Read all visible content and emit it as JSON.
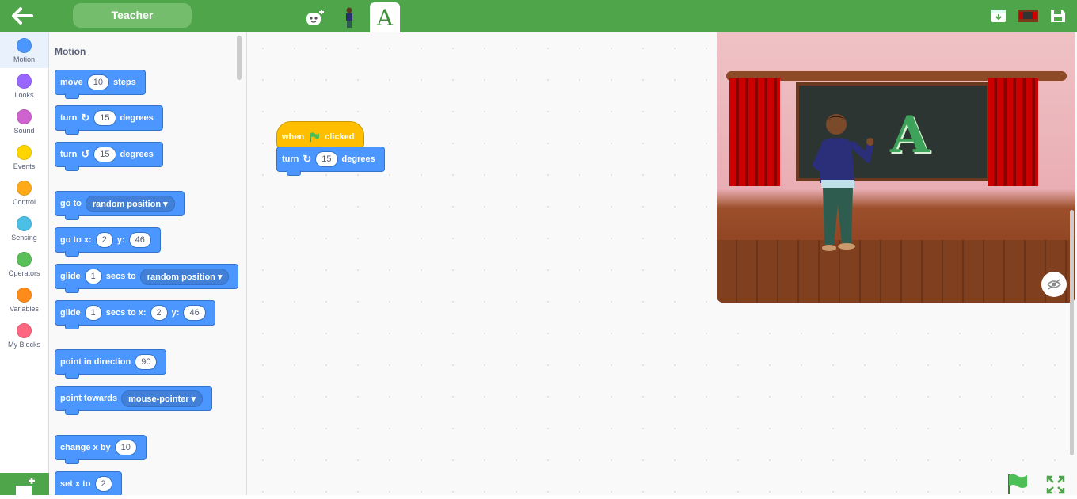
{
  "header": {
    "sprite_name": "Teacher",
    "icons": [
      "back-arrow-icon",
      "code-tab-icon",
      "costume-tab-icon",
      "text-tab-icon",
      "download-icon",
      "stage-icon",
      "save-icon"
    ],
    "tab_text_glyph": "A"
  },
  "categories": [
    {
      "label": "Motion",
      "color": "#4c97ff"
    },
    {
      "label": "Looks",
      "color": "#9966ff"
    },
    {
      "label": "Sound",
      "color": "#cf63cf"
    },
    {
      "label": "Events",
      "color": "#ffd500"
    },
    {
      "label": "Control",
      "color": "#ffab19"
    },
    {
      "label": "Sensing",
      "color": "#4cbfe6"
    },
    {
      "label": "Operators",
      "color": "#59c059"
    },
    {
      "label": "Variables",
      "color": "#ff8c1a"
    },
    {
      "label": "My Blocks",
      "color": "#ff6680"
    }
  ],
  "palette": {
    "title": "Motion",
    "move": {
      "a": "move",
      "n": "10",
      "b": "steps"
    },
    "turn_right": {
      "a": "turn",
      "n": "15",
      "b": "degrees"
    },
    "turn_left": {
      "a": "turn",
      "n": "15",
      "b": "degrees"
    },
    "goto": {
      "a": "go to",
      "d": "random position"
    },
    "goto_xy": {
      "a": "go to x:",
      "x": "2",
      "b": "y:",
      "y": "46"
    },
    "glide_to": {
      "a": "glide",
      "n": "1",
      "b": "secs to",
      "d": "random position"
    },
    "glide_xy": {
      "a": "glide",
      "n": "1",
      "b": "secs to x:",
      "x": "2",
      "c": "y:",
      "y": "46"
    },
    "point_dir": {
      "a": "point in direction",
      "n": "90"
    },
    "point_towards": {
      "a": "point towards",
      "d": "mouse-pointer"
    },
    "change_x": {
      "a": "change x by",
      "n": "10"
    },
    "set_x": {
      "a": "set x to",
      "n": "2"
    }
  },
  "workspace": {
    "hat": {
      "a": "when",
      "b": "clicked"
    },
    "turn": {
      "a": "turn",
      "n": "15",
      "b": "degrees"
    }
  },
  "stage": {
    "board_letter": "A",
    "controls": [
      "hide-stage-icon",
      "green-flag-icon",
      "fullscreen-icon"
    ]
  }
}
